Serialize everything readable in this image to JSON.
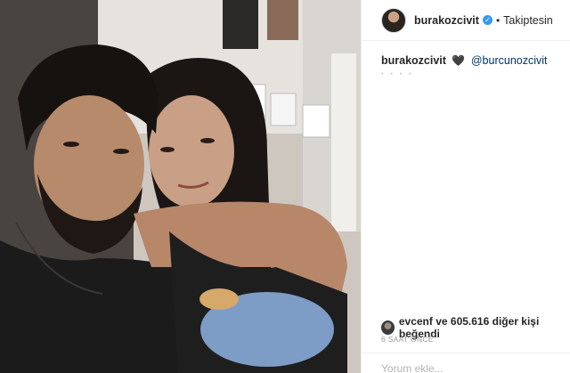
{
  "post": {
    "photo_description_icon": "photo-of-couple",
    "header": {
      "username": "burakozcivit",
      "verified_icon": "verified-badge-icon",
      "separator": "•",
      "follow_status": "Takiptesin"
    },
    "caption": {
      "username": "burakozcivit",
      "emoji": "🖤",
      "mention": "@burcunozcivit",
      "dots": "• • • •"
    },
    "likes": {
      "text": "evcenf ve 605.616 diğer kişi beğendi"
    },
    "timestamp": "6 SAAT ÖNCE",
    "comment": {
      "placeholder": "Yorum ekle..."
    }
  },
  "colors": {
    "link": "#003569",
    "verified": "#3897f0",
    "muted": "#999999"
  }
}
